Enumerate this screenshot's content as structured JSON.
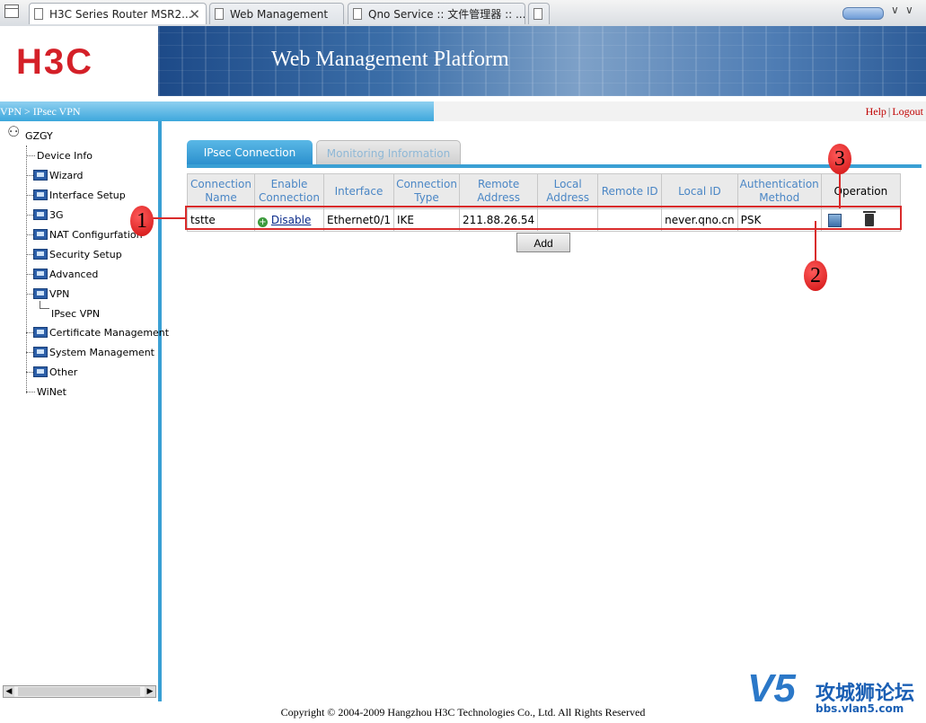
{
  "browser": {
    "tabs": [
      {
        "label": "H3C Series Router MSR2...",
        "active": true
      },
      {
        "label": "Web Management",
        "active": false
      },
      {
        "label": "Qno Service :: 文件管理器 :: ...",
        "active": false
      },
      {
        "label": "",
        "active": false
      }
    ],
    "close_glyph": "✕"
  },
  "header": {
    "logo_text": "H3C",
    "title": "Web Management Platform"
  },
  "breadcrumb": "VPN > IPsec VPN",
  "top_links": {
    "help": "Help",
    "separator": "|",
    "logout": "Logout"
  },
  "sidebar": {
    "root": "GZGY",
    "items": [
      {
        "label": "Device Info",
        "icon": "none"
      },
      {
        "label": "Wizard",
        "icon": "folder-icon"
      },
      {
        "label": "Interface Setup",
        "icon": "folder-icon"
      },
      {
        "label": "3G",
        "icon": "folder-icon"
      },
      {
        "label": "NAT Configurfation",
        "icon": "folder-icon"
      },
      {
        "label": "Security Setup",
        "icon": "folder-icon"
      },
      {
        "label": "Advanced",
        "icon": "folder-icon"
      },
      {
        "label": "VPN",
        "icon": "folder-open-icon"
      },
      {
        "label": "IPsec VPN",
        "icon": "none"
      },
      {
        "label": "Certificate Management",
        "icon": "folder-icon"
      },
      {
        "label": "System Management",
        "icon": "folder-icon"
      },
      {
        "label": "Other",
        "icon": "folder-icon"
      },
      {
        "label": "WiNet",
        "icon": "none"
      }
    ]
  },
  "content_tabs": [
    {
      "label": "IPsec Connection",
      "active": true
    },
    {
      "label": "Monitoring Information",
      "active": false
    }
  ],
  "table": {
    "headers": [
      "Connection Name",
      "Enable Connection",
      "Interface",
      "Connection Type",
      "Remote Address",
      "Local Address",
      "Remote ID",
      "Local ID",
      "Authentication Method",
      "Operation"
    ],
    "rows": [
      {
        "connection_name": "tstte",
        "enable_connection": "Disable",
        "interface": "Ethernet0/1",
        "connection_type": "IKE",
        "remote_address": "211.88.26.54",
        "local_address": "",
        "remote_id": "",
        "local_id": "never.qno.cn",
        "auth_method": "PSK"
      }
    ]
  },
  "add_button": "Add",
  "callouts": [
    "1",
    "2",
    "3"
  ],
  "footer": "Copyright © 2004-2009 Hangzhou H3C Technologies Co., Ltd. All Rights Reserved",
  "watermark": {
    "logo": "V5",
    "name": "攻城狮论坛",
    "url": "bbs.vlan5.com"
  },
  "colors": {
    "accent": "#3aa0d4",
    "brand_red": "#d42028",
    "callout_red": "#d92b2b",
    "header_link": "#4a86c5"
  }
}
